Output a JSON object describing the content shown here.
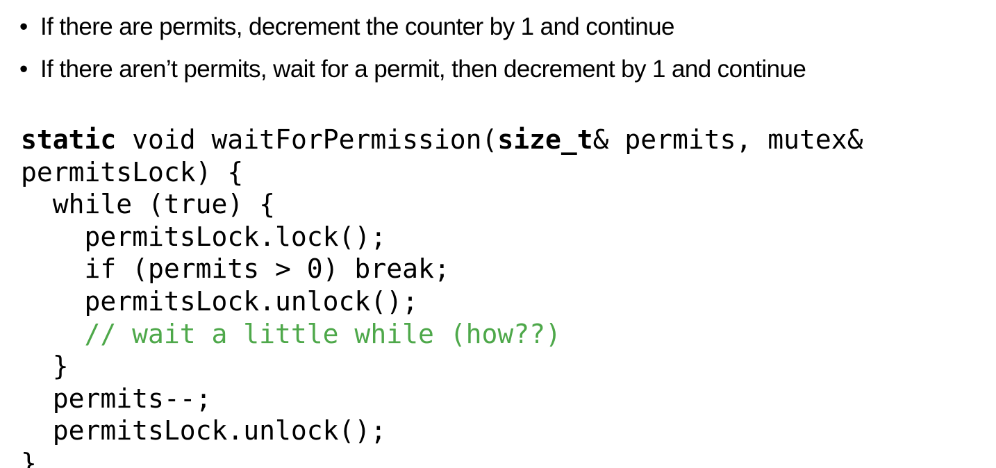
{
  "bullets": [
    "If there are permits, decrement the counter by 1 and continue",
    "If there aren’t permits, wait for a permit, then decrement by 1 and continue"
  ],
  "bullet_symbol": "•",
  "code": {
    "line1": {
      "kw1": "static",
      "t1": " void waitForPermission(",
      "kw2": "size_t",
      "t2": "& permits, mutex&"
    },
    "line2": "permitsLock) {",
    "line3": "  while (true) {",
    "line4": "    permitsLock.lock();",
    "line5": "    if (permits > 0) break;",
    "line6": "    permitsLock.unlock();",
    "line7_comment": "    // wait a little while (how??)",
    "line8": "  }",
    "line9": "  permits--;",
    "line10": "  permitsLock.unlock();",
    "line11": "}"
  },
  "colors": {
    "comment": "#4ea84a",
    "text": "#000000",
    "background": "#ffffff"
  }
}
